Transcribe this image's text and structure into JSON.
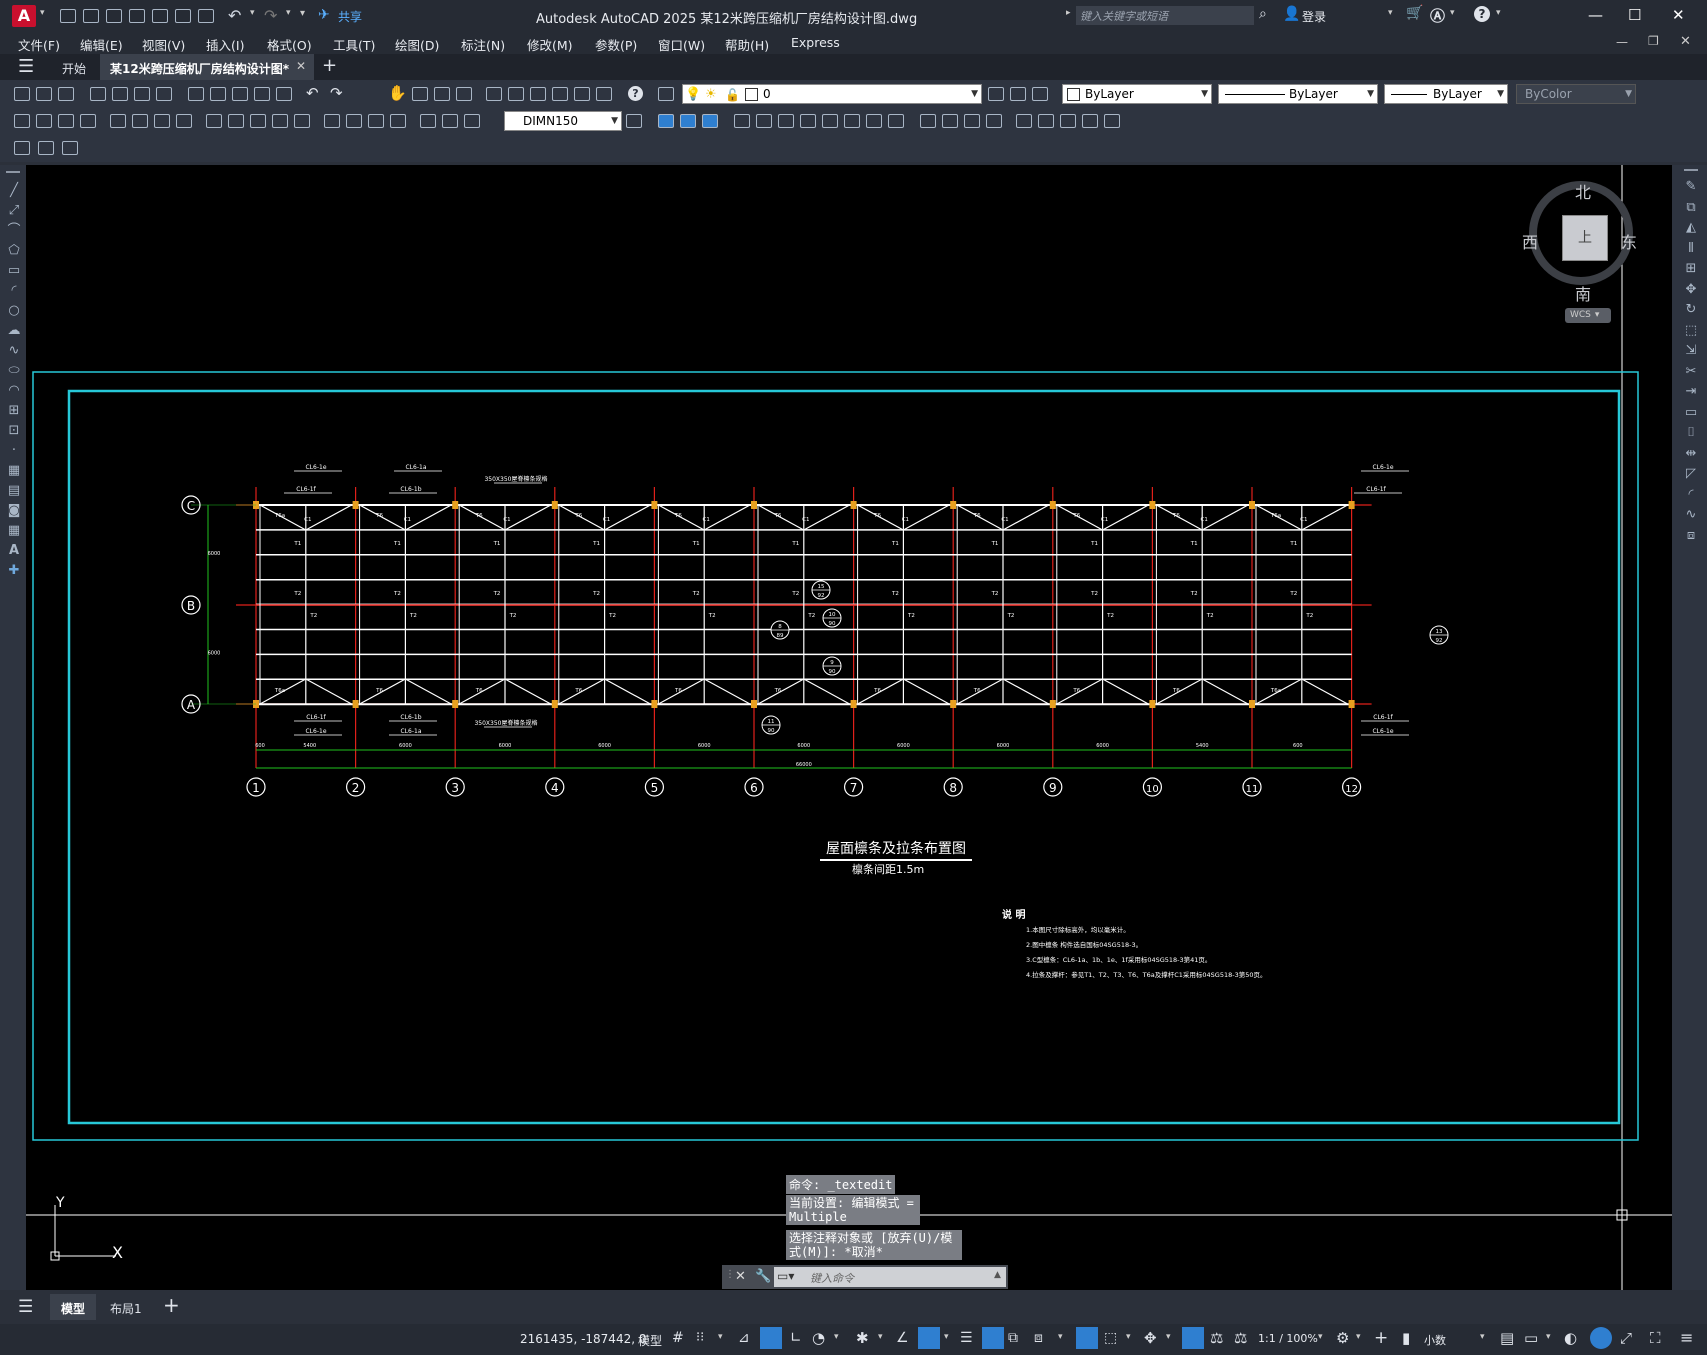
{
  "titlebar": {
    "app_logo": "A",
    "share_label": "共享",
    "title": "Autodesk AutoCAD 2025    某12米跨压缩机厂房结构设计图.dwg",
    "search_placeholder": "键入关键字或短语",
    "login_label": "登录"
  },
  "menus": [
    "文件(F)",
    "编辑(E)",
    "视图(V)",
    "插入(I)",
    "格式(O)",
    "工具(T)",
    "绘图(D)",
    "标注(N)",
    "修改(M)",
    "参数(P)",
    "窗口(W)",
    "帮助(H)",
    "Express"
  ],
  "tabs": {
    "start": "开始",
    "active": "某12米跨压缩机厂房结构设计图*"
  },
  "toolbar": {
    "layer_value": "0",
    "color_value": "ByLayer",
    "linetype_value": "ByLayer",
    "lineweight_value": "ByLayer",
    "plotstyle_value": "ByColor",
    "dimstyle_value": "DIMN150"
  },
  "viewcube": {
    "north": "北",
    "south": "南",
    "east": "东",
    "west": "西",
    "top": "上",
    "wcs": "WCS"
  },
  "drawing": {
    "title": "屋面檩条及拉条布置图",
    "subtitle": "檩条间距1.5m",
    "notes_title": "说  明",
    "notes": [
      "1.本图尺寸除标高外，均以毫米计。",
      "2.图中檩条   构件选自国标04SG518-3。",
      "3.C型檩条：CL6-1a、1b、1e、1f采用标04SG518-3第41页。",
      "4.拉条及撑杆：参见T1、T2、T3、T6、T6a及撑杆C1采用标04SG518-3第50页。"
    ],
    "axes_x": [
      "1",
      "2",
      "3",
      "4",
      "5",
      "6",
      "7",
      "8",
      "9",
      "10",
      "11",
      "12"
    ],
    "axes_y": [
      "C",
      "B",
      "A"
    ],
    "dims": [
      "600",
      "5400",
      "6000",
      "6000",
      "6000",
      "6000",
      "6000",
      "6000",
      "6000",
      "6000",
      "5400",
      "600"
    ],
    "total_dim": "66000",
    "side_dims": [
      "6000",
      "6000"
    ],
    "callouts_top": [
      "CL6-1e",
      "CL6-1f",
      "CL6-1a",
      "CL6-1b",
      "350X350屋脊檩条规格",
      "CL6-1e",
      "CL6-1f"
    ],
    "callouts_bottom": [
      "CL6-1f",
      "CL6-1e",
      "CL6-1b",
      "CL6-1a",
      "350X350屋脊檩条规格",
      "CL6-1f",
      "CL6-1e"
    ],
    "detail_tags": [
      [
        "15",
        "92"
      ],
      [
        "10",
        "90"
      ],
      [
        "8",
        "89"
      ],
      [
        "9",
        "90"
      ],
      [
        "11",
        "90"
      ],
      [
        "13",
        "92"
      ]
    ],
    "member_labels": [
      "T6a",
      "C1",
      "T6",
      "T1",
      "T2",
      "T3"
    ]
  },
  "command": {
    "history": [
      "命令: _textedit",
      "当前设置: 编辑模式 = Multiple",
      "选择注释对象或 [放弃(U)/模式(M)]: *取消*"
    ],
    "input_placeholder": "键入命令"
  },
  "layout_tabs": [
    "模型",
    "布局1"
  ],
  "status": {
    "coords": "2161435, -187442, 0",
    "model": "模型",
    "scale": "1:1 / 100%",
    "units": "小数"
  },
  "ucs": {
    "x": "X",
    "y": "Y"
  }
}
